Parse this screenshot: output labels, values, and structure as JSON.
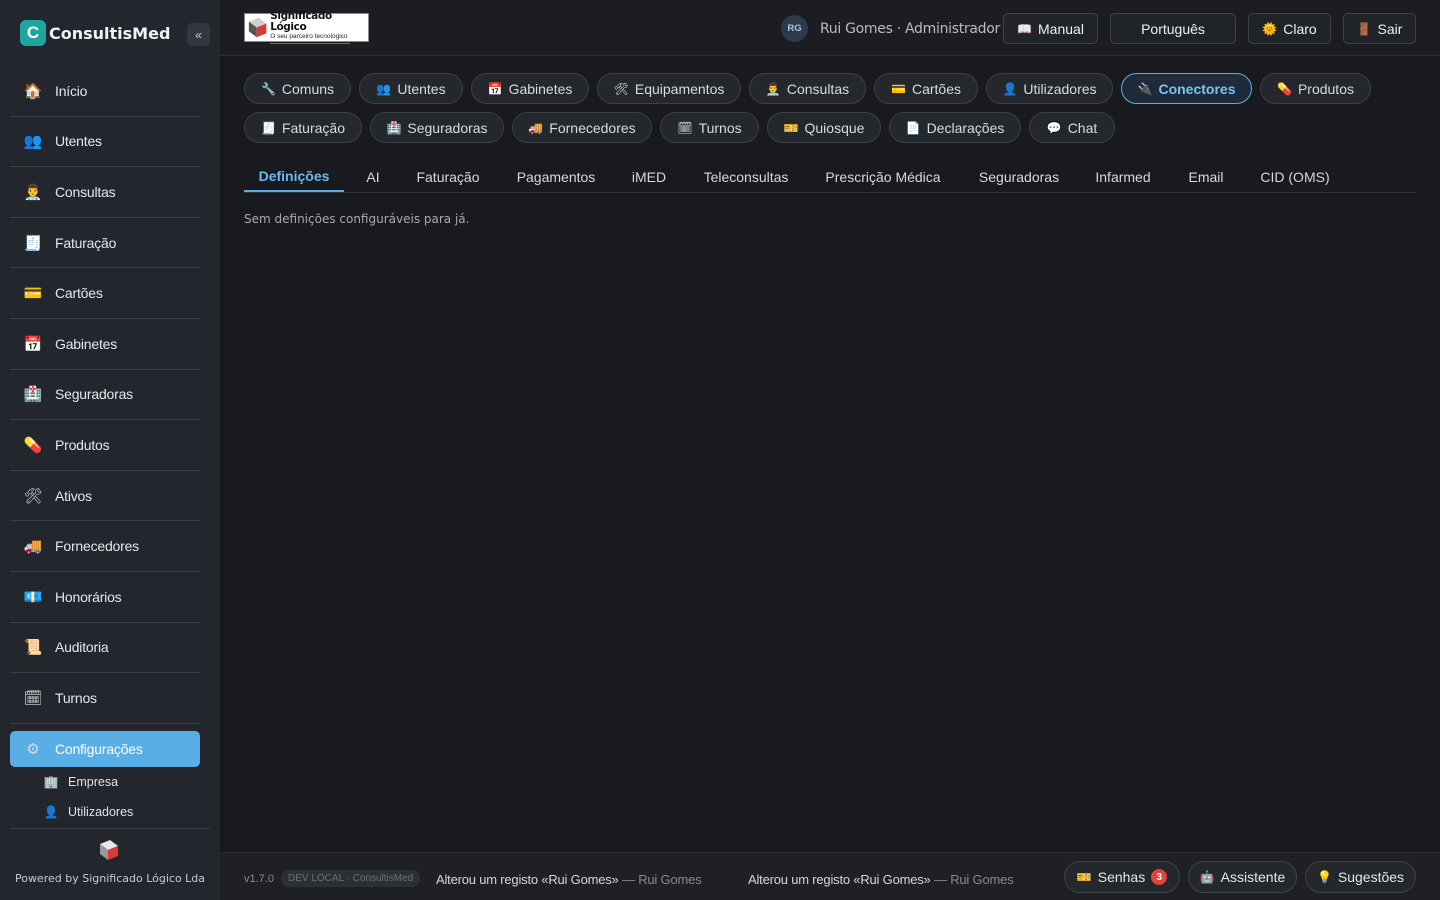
{
  "app": {
    "brand_letter": "C",
    "name": "ConsultisMed",
    "collapse_glyph": "«",
    "powered_by": "Powered by Significado Lógico Lda"
  },
  "sidebar": {
    "items": [
      {
        "label": "Início",
        "icon": "house-icon",
        "glyph": "🏠"
      },
      {
        "label": "Utentes",
        "icon": "patients-icon",
        "glyph": "👥"
      },
      {
        "label": "Consultas",
        "icon": "doctor-icon",
        "glyph": "👨‍⚕️"
      },
      {
        "label": "Faturação",
        "icon": "invoice-icon",
        "glyph": "🧾"
      },
      {
        "label": "Cartões",
        "icon": "card-icon",
        "glyph": "💳"
      },
      {
        "label": "Gabinetes",
        "icon": "calendar-icon",
        "glyph": "📅"
      },
      {
        "label": "Seguradoras",
        "icon": "insurance-icon",
        "glyph": "🏥"
      },
      {
        "label": "Produtos",
        "icon": "pill-icon",
        "glyph": "💊"
      },
      {
        "label": "Ativos",
        "icon": "tools-icon",
        "glyph": "🛠"
      },
      {
        "label": "Fornecedores",
        "icon": "truck-icon",
        "glyph": "🚚"
      },
      {
        "label": "Honorários",
        "icon": "money-icon",
        "glyph": "💶"
      },
      {
        "label": "Auditoria",
        "icon": "scroll-icon",
        "glyph": "📜"
      },
      {
        "label": "Turnos",
        "icon": "schedule-icon",
        "glyph": "🗓"
      }
    ],
    "active": {
      "label": "Configurações",
      "icon": "gear-icon",
      "glyph": "⚙"
    },
    "sub_items": [
      {
        "label": "Empresa",
        "icon": "building-icon",
        "glyph": "🏢"
      },
      {
        "label": "Utilizadores",
        "icon": "user-icon",
        "glyph": "👤"
      }
    ]
  },
  "header": {
    "company_logo": {
      "title": "Significado Lógico",
      "tagline": "O seu parceiro tecnológico"
    },
    "user_initials": "RG",
    "user_text": "Rui Gomes · Administrador",
    "manual_label": "Manual",
    "manual_glyph": "📖",
    "language_label": "Português",
    "theme_label": "Claro",
    "theme_glyph": "🌞",
    "logout_label": "Sair",
    "logout_glyph": "🚪"
  },
  "pills_row1": [
    {
      "label": "Comuns",
      "glyph": "🔧"
    },
    {
      "label": "Utentes",
      "glyph": "👥"
    },
    {
      "label": "Gabinetes",
      "glyph": "📅"
    },
    {
      "label": "Equipamentos",
      "glyph": "🛠"
    },
    {
      "label": "Consultas",
      "glyph": "👨‍⚕️"
    },
    {
      "label": "Cartões",
      "glyph": "💳"
    },
    {
      "label": "Utilizadores",
      "glyph": "👤"
    },
    {
      "label": "Conectores",
      "glyph": "🔌"
    },
    {
      "label": "Produtos",
      "glyph": "💊"
    }
  ],
  "pills_row2": [
    {
      "label": "Faturação",
      "glyph": "🧾"
    },
    {
      "label": "Seguradoras",
      "glyph": "🏥"
    },
    {
      "label": "Fornecedores",
      "glyph": "🚚"
    },
    {
      "label": "Turnos",
      "glyph": "🗓"
    },
    {
      "label": "Quiosque",
      "glyph": "🎫"
    },
    {
      "label": "Declarações",
      "glyph": "📄"
    },
    {
      "label": "Chat",
      "glyph": "💬"
    }
  ],
  "subtabs": [
    "Definições",
    "AI",
    "Faturação",
    "Pagamentos",
    "iMED",
    "Teleconsultas",
    "Prescrição Médica",
    "Seguradoras",
    "Infarmed",
    "Email",
    "CID (OMS)"
  ],
  "content": {
    "empty_message": "Sem definições configuráveis para já."
  },
  "footer": {
    "version": "v1.7.0",
    "env_badge": "DEV LOCAL · ConsultisMed",
    "activity": [
      {
        "text": "Alterou um registo «Rui Gomes»",
        "who": " — Rui Gomes"
      },
      {
        "text": "Alterou um registo «Rui Gomes»",
        "who": " — Rui Gomes"
      }
    ],
    "senhas_label": "Senhas",
    "senhas_glyph": "🎫",
    "senhas_count": "3",
    "assistente_label": "Assistente",
    "assistente_glyph": "🤖",
    "sugestoes_label": "Sugestões",
    "sugestoes_glyph": "💡"
  },
  "colors": {
    "accent": "#5aaee6",
    "background": "#181a1f",
    "sidebar": "#23262c",
    "badge": "#e0443a"
  }
}
